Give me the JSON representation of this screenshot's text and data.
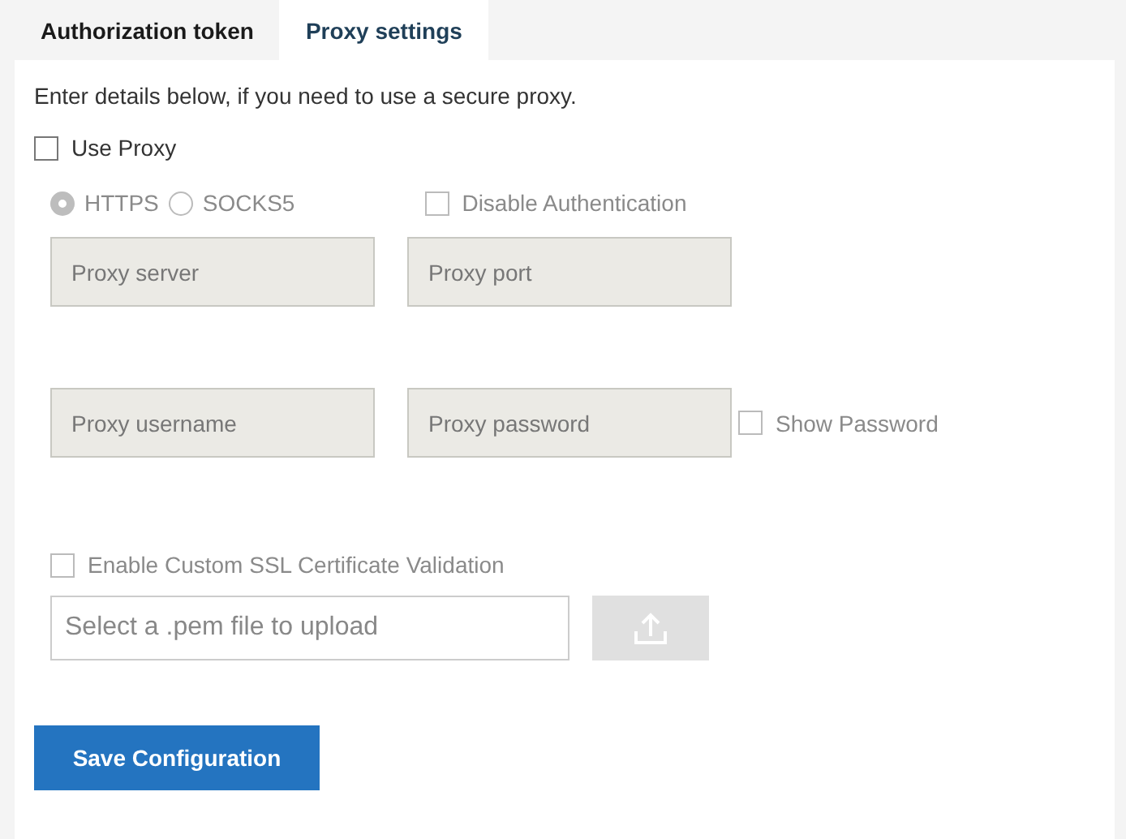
{
  "tabs": [
    {
      "label": "Authorization token",
      "selected": false
    },
    {
      "label": "Proxy settings",
      "selected": true
    }
  ],
  "intro": "Enter details below, if you need to use a secure proxy.",
  "use_proxy": {
    "label": "Use Proxy",
    "checked": false
  },
  "protocols": [
    {
      "label": "HTTPS",
      "selected": true,
      "disabled": true
    },
    {
      "label": "SOCKS5",
      "selected": false,
      "disabled": true
    }
  ],
  "disable_auth": {
    "label": "Disable Authentication",
    "checked": false,
    "disabled": true
  },
  "server_fields": [
    {
      "placeholder": "Proxy server",
      "disabled": true
    },
    {
      "placeholder": "Proxy port",
      "disabled": true
    }
  ],
  "auth_fields": [
    {
      "placeholder": "Proxy username",
      "disabled": true
    },
    {
      "placeholder": "Proxy password",
      "disabled": true
    }
  ],
  "show_password": {
    "label": "Show Password",
    "checked": false,
    "disabled": true
  },
  "ssl": {
    "label": "Enable Custom SSL Certificate Validation",
    "checked": false,
    "disabled": true
  },
  "file": {
    "placeholder": "Select a .pem file to upload",
    "upload_disabled": true
  },
  "save_button": "Save Configuration"
}
